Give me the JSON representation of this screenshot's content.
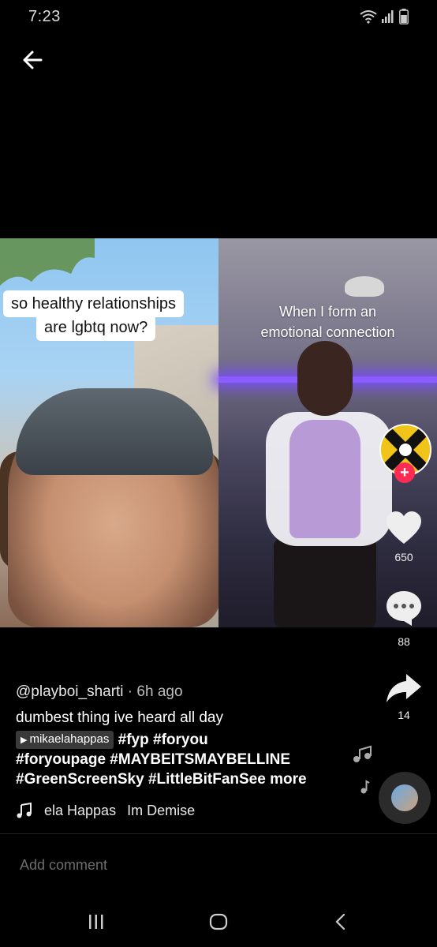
{
  "status_bar": {
    "time": "7:23",
    "icons": [
      "wifi-icon",
      "signal-icon",
      "battery-icon"
    ]
  },
  "video": {
    "left_caption_line1": "so healthy relationships",
    "left_caption_line2": "are lgbtq now?",
    "right_caption_line1": "When I form an",
    "right_caption_line2": "emotional connection"
  },
  "rail": {
    "follow_symbol": "+",
    "likes": "650",
    "comments": "88",
    "shares": "14"
  },
  "post": {
    "username": "@playboi_sharti",
    "separator": " · ",
    "time_ago": "6h ago",
    "description": "dumbest thing ive heard all day",
    "stitch_chip": "mikaelahappas",
    "tags_line1": " #fyp #foryou",
    "tags_line2": "#foryoupage #MAYBEITSMAYBELLINE",
    "tags_line3": "#GreenScreenSky #LittleBitFan",
    "see_more": "See more",
    "music_part1": "ela Happas",
    "music_part2": "Im Demise"
  },
  "comment_bar": {
    "placeholder": "Add comment"
  },
  "colors": {
    "accent": "#fe2c55",
    "background": "#000000"
  }
}
